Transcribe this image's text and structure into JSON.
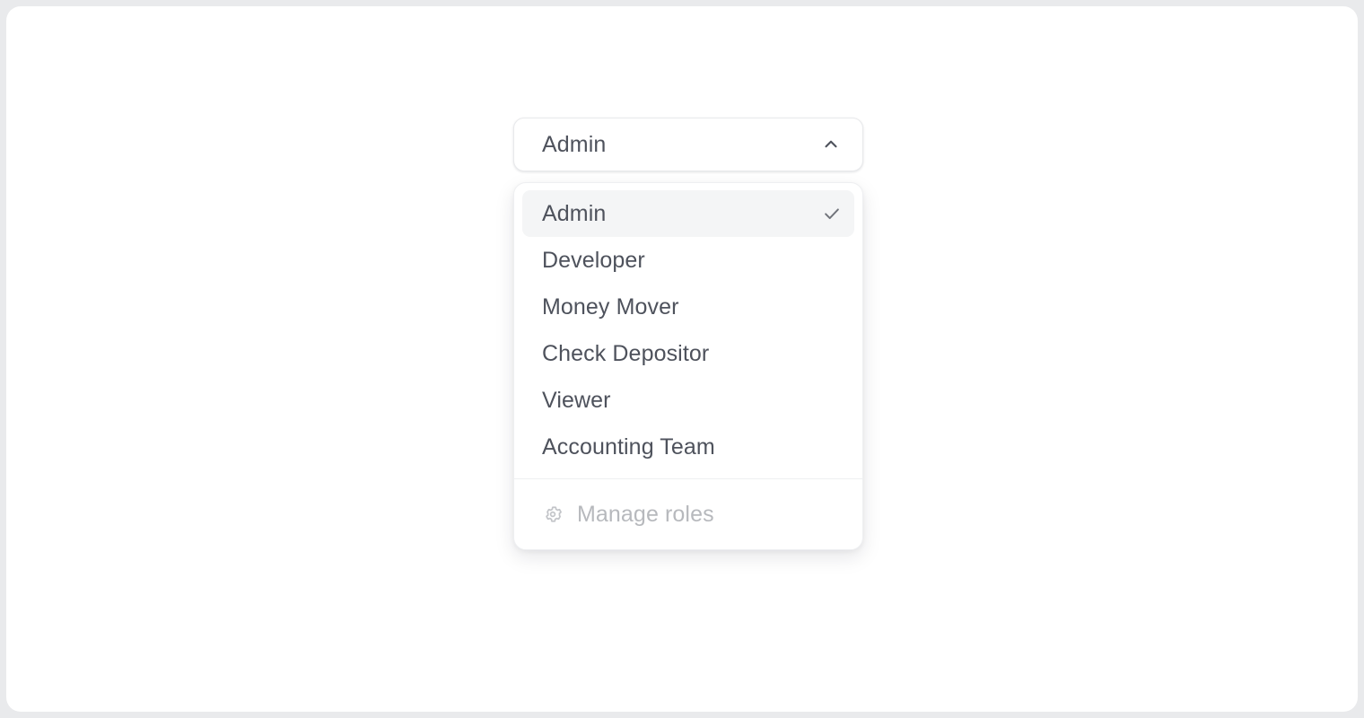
{
  "select": {
    "name": "role-select",
    "selected_value": "Admin",
    "expanded": true,
    "chevron_icon": "chevron-up-icon",
    "chevron_color": "#4e525c",
    "border_color": "#e8e9eb",
    "text_color": "#4e525c",
    "background": "#ffffff"
  },
  "dropdown": {
    "options": [
      {
        "label": "Admin",
        "selected": true,
        "check_icon": "check-icon"
      },
      {
        "label": "Developer",
        "selected": false,
        "check_icon": "check-icon"
      },
      {
        "label": "Money Mover",
        "selected": false,
        "check_icon": "check-icon"
      },
      {
        "label": "Check Depositor",
        "selected": false,
        "check_icon": "check-icon"
      },
      {
        "label": "Viewer",
        "selected": false,
        "check_icon": "check-icon"
      },
      {
        "label": "Accounting Team",
        "selected": false,
        "check_icon": "check-icon"
      }
    ],
    "selected_highlight_color": "#f4f5f6",
    "divider_color": "#eeeff1",
    "footer": {
      "label": "Manage roles",
      "icon": "gear-icon",
      "text_color": "#b7b9bd",
      "icon_color": "#c3c5c9"
    }
  },
  "page": {
    "background": "#ffffff",
    "canvas_background": "#e9eaec"
  }
}
